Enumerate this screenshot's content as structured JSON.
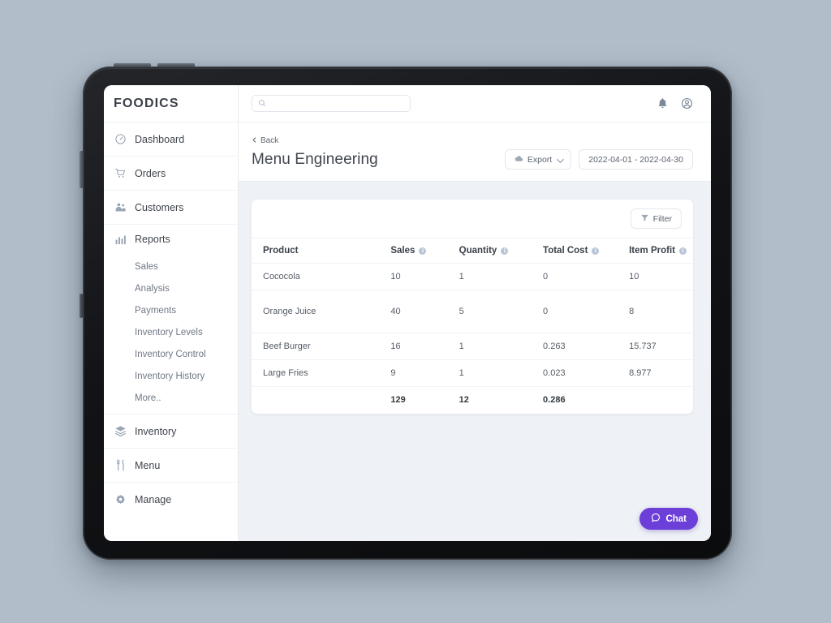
{
  "brand": {
    "name": "FOODICS"
  },
  "topbar": {
    "search_placeholder": "",
    "search_value": "",
    "search_icon": "search-icon",
    "notification_icon": "bell-icon",
    "account_icon": "user-avatar-icon"
  },
  "sidebar": {
    "items": [
      {
        "label": "Dashboard",
        "icon": "gauge-icon"
      },
      {
        "label": "Orders",
        "icon": "shopping-cart-icon"
      },
      {
        "label": "Customers",
        "icon": "users-icon"
      },
      {
        "label": "Reports",
        "icon": "bar-chart-icon"
      },
      {
        "label": "Inventory",
        "icon": "layers-icon"
      },
      {
        "label": "Menu",
        "icon": "cutlery-icon"
      },
      {
        "label": "Manage",
        "icon": "gear-icon"
      }
    ],
    "reports_subitems": [
      {
        "label": "Sales"
      },
      {
        "label": "Analysis"
      },
      {
        "label": "Payments"
      },
      {
        "label": "Inventory Levels"
      },
      {
        "label": "Inventory Control"
      },
      {
        "label": "Inventory History"
      },
      {
        "label": "More.."
      }
    ]
  },
  "page": {
    "back_label": "Back",
    "title": "Menu Engineering",
    "export_label": "Export",
    "export_icon": "cloud-icon",
    "date_range": "2022-04-01 - 2022-04-30",
    "filter_label": "Filter",
    "filter_icon": "funnel-icon"
  },
  "table": {
    "columns": [
      {
        "label": "Product",
        "has_info": false
      },
      {
        "label": "Sales",
        "has_info": true
      },
      {
        "label": "Quantity",
        "has_info": true
      },
      {
        "label": "Total Cost",
        "has_info": true
      },
      {
        "label": "Item Profit",
        "has_info": true
      }
    ],
    "rows": [
      {
        "product": "Cococola",
        "sales": "10",
        "quantity": "1",
        "total_cost": "0",
        "item_profit": "10"
      },
      {
        "product": "Orange Juice",
        "sales": "40",
        "quantity": "5",
        "total_cost": "0",
        "item_profit": "8"
      },
      {
        "product": "Beef Burger",
        "sales": "16",
        "quantity": "1",
        "total_cost": "0.263",
        "item_profit": "15.737"
      },
      {
        "product": "Large Fries",
        "sales": "9",
        "quantity": "1",
        "total_cost": "0.023",
        "item_profit": "8.977"
      }
    ],
    "totals": {
      "product": "",
      "sales": "129",
      "quantity": "12",
      "total_cost": "0.286",
      "item_profit": ""
    }
  },
  "chat": {
    "label": "Chat",
    "icon": "chat-bubble-icon",
    "color": "#6c3fd8"
  }
}
